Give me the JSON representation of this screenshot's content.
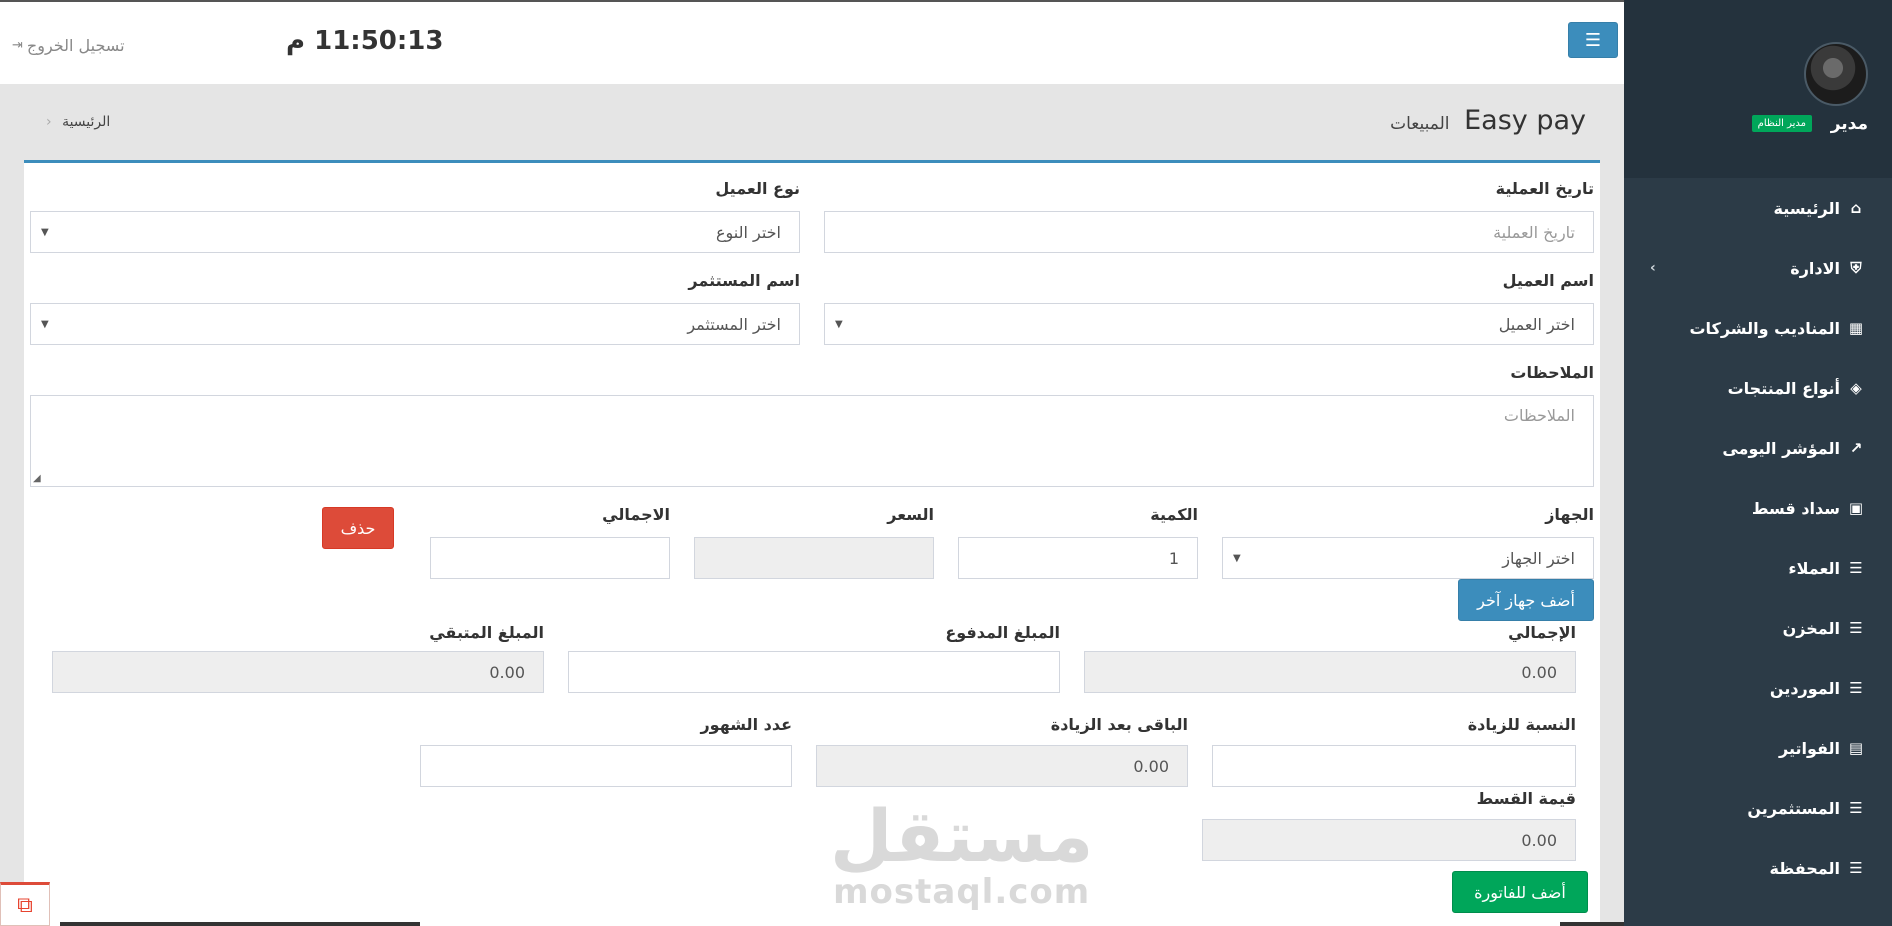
{
  "header": {
    "clock": "11:50:13 م",
    "logout_label": "تسجيل الخروج",
    "logout_icon": "sign-out-icon",
    "menu_icon": "bars-icon"
  },
  "user": {
    "name": "مدير",
    "role_badge": "مدير النظام"
  },
  "sidebar": {
    "items": [
      {
        "label": "الرئيسية",
        "icon": "⌂"
      },
      {
        "label": "الادارة",
        "icon": "⛨",
        "has_children": true
      },
      {
        "label": "المناديب والشركات",
        "icon": "▦"
      },
      {
        "label": "أنواع المنتجات",
        "icon": "◈"
      },
      {
        "label": "المؤشر اليومى",
        "icon": "↗"
      },
      {
        "label": "سداد قسط",
        "icon": "▣"
      },
      {
        "label": "العملاء",
        "icon": "☰"
      },
      {
        "label": "المخزن",
        "icon": "☰"
      },
      {
        "label": "الموردين",
        "icon": "☰"
      },
      {
        "label": "الفواتير",
        "icon": "▤"
      },
      {
        "label": "المستثمرين",
        "icon": "☰"
      },
      {
        "label": "المحفظة",
        "icon": "☰"
      }
    ]
  },
  "page": {
    "title": "Easy pay",
    "subtitle": "المبيعات",
    "breadcrumb": "الرئيسية"
  },
  "form": {
    "operation_date": {
      "label": "تاريخ العملية",
      "placeholder": "تاريخ العملية"
    },
    "customer_type": {
      "label": "نوع العميل",
      "value": "اختر النوع"
    },
    "customer_name": {
      "label": "اسم العميل",
      "value": "اختر العميل"
    },
    "investor_name": {
      "label": "اسم المستثمر",
      "value": "اختر المستثمر"
    },
    "notes": {
      "label": "الملاحظات",
      "placeholder": "الملاحظات"
    },
    "device": {
      "label": "الجهاز",
      "value": "اختر الجهاز"
    },
    "quantity": {
      "label": "الكمية",
      "value": "1"
    },
    "price": {
      "label": "السعر",
      "value": ""
    },
    "line_total": {
      "label": "الاجمالي",
      "value": ""
    },
    "delete_button": "حذف",
    "add_device_button": "أضف جهاز آخر",
    "grand_total": {
      "label": "الإجمالي",
      "value": "0.00"
    },
    "paid_amount": {
      "label": "المبلغ المدفوع",
      "value": ""
    },
    "remaining_amount": {
      "label": "المبلغ المتبقي",
      "value": "0.00"
    },
    "increase_rate": {
      "label": "النسبة للزيادة",
      "value": ""
    },
    "remaining_after_increase": {
      "label": "الباقى بعد الزيادة",
      "value": "0.00"
    },
    "months_count": {
      "label": "عدد الشهور",
      "value": ""
    },
    "installment_value": {
      "label": "قيمة القسط",
      "value": "0.00"
    },
    "add_to_invoice_button": "أضف للفاتورة"
  },
  "watermark": {
    "arabic": "مستقل",
    "latin": "mostaql.com"
  }
}
